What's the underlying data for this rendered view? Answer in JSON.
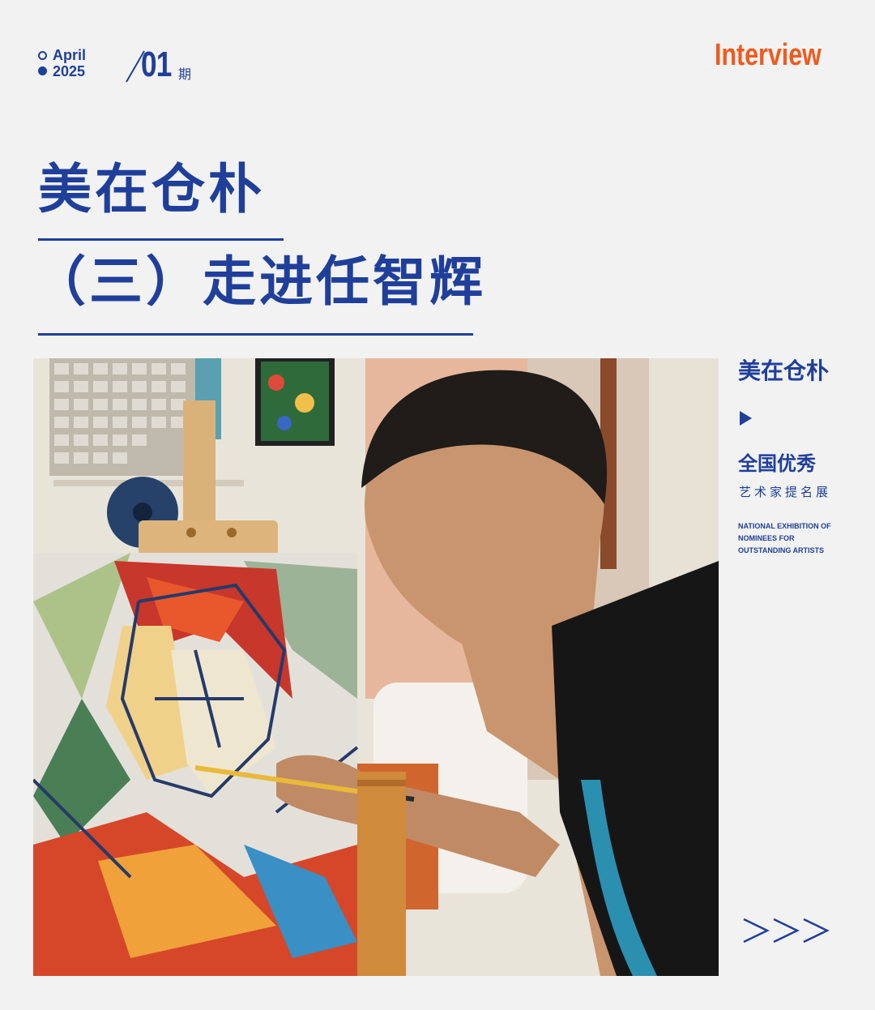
{
  "header": {
    "month": "April",
    "year": "2025",
    "issue_number": "01",
    "issue_unit": "期",
    "brand": "Interview"
  },
  "titles": {
    "line1": "美在仓朴",
    "line2": "（三）走进任智辉"
  },
  "sidebar": {
    "title": "美在仓朴",
    "subtitle_cn": "全国优秀",
    "subtitle_cn2": "艺术家提名展",
    "subtitle_en": "NATIONAL EXHIBITION OF NOMINEES FOR OUTSTANDING ARTISTS"
  },
  "colors": {
    "primary": "#1f3f9a",
    "accent": "#f05a1e",
    "background": "#f2f2f2"
  },
  "icons": [
    "slash-divider",
    "play-arrow-icon",
    "triple-chevron-icon"
  ]
}
